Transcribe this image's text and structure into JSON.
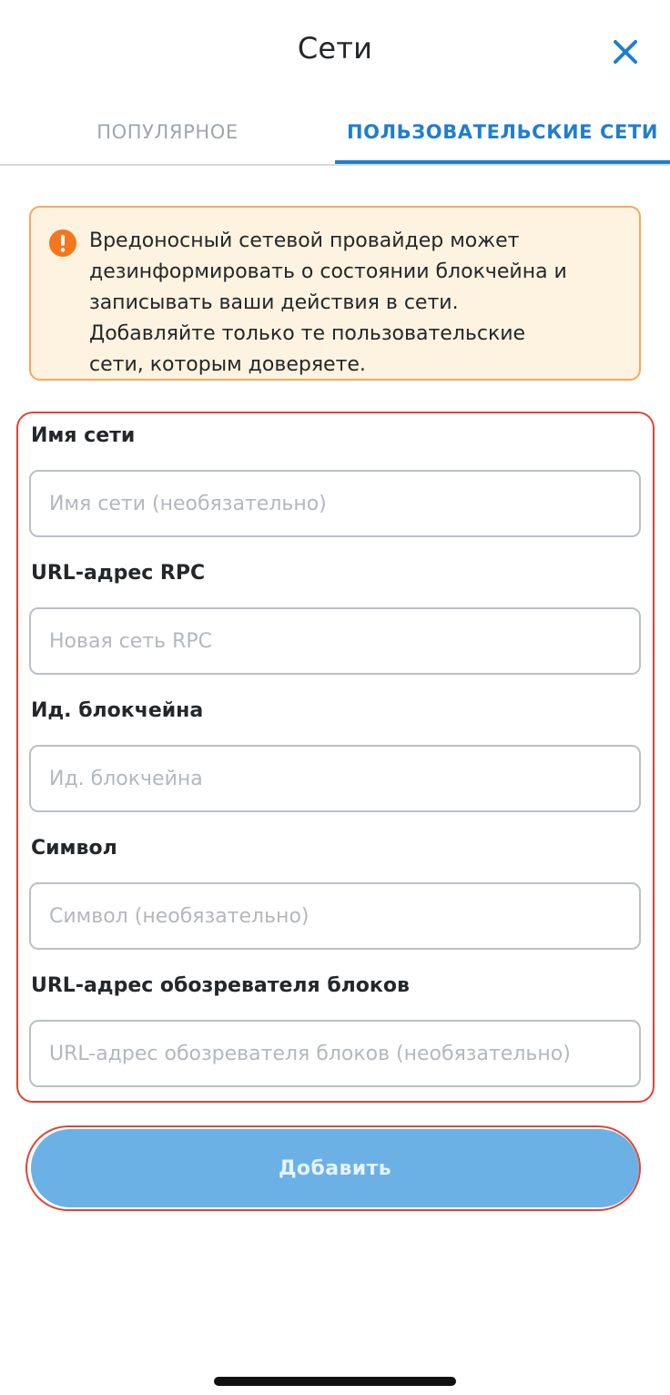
{
  "header": {
    "title": "Сети",
    "close_icon": "close-icon",
    "accent_color": "#1f7ed0"
  },
  "tabs": [
    {
      "label": "ПОПУЛЯРНОЕ",
      "active": false
    },
    {
      "label": "ПОЛЬЗОВАТЕЛЬСКИЕ СЕТИ",
      "active": true
    }
  ],
  "warning": {
    "icon": "exclamation-circle-icon",
    "text": "Вредоносный сетевой провайдер может\nдезинформировать о состоянии блокчейна и\nзаписывать ваши действия в сети.\nДобавляйте только те пользовательские\nсети, которым доверяете.",
    "icon_color": "#f4771d",
    "background": "#fef3e0",
    "border": "#f5a85c"
  },
  "form": {
    "fields": [
      {
        "label": "Имя сети",
        "placeholder": "Имя сети (необязательно)",
        "value": ""
      },
      {
        "label": "URL-адрес RPC",
        "placeholder": "Новая сеть RPC",
        "value": ""
      },
      {
        "label": "Ид. блокчейна",
        "placeholder": "Ид. блокчейна",
        "value": ""
      },
      {
        "label": "Символ",
        "placeholder": "Символ (необязательно)",
        "value": ""
      },
      {
        "label": "URL-адрес обозревателя блоков",
        "placeholder": "URL-адрес обозревателя блоков (необязательно)",
        "value": ""
      }
    ],
    "highlight_color": "#e0442f"
  },
  "submit": {
    "label": "Добавить",
    "disabled": true,
    "color": "#6cb1e6"
  }
}
